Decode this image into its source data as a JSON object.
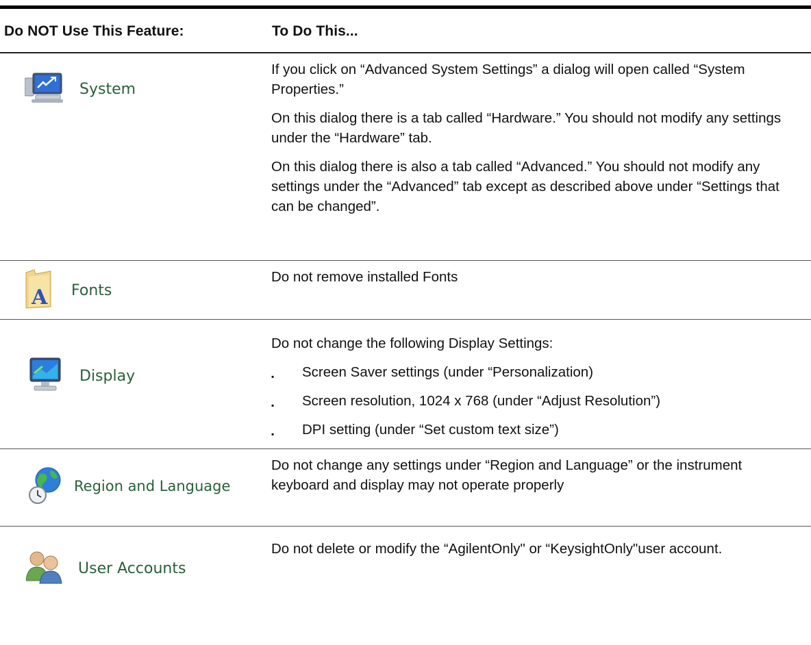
{
  "table": {
    "col1_header": "Do NOT Use This Feature:",
    "col2_header": "To Do This...",
    "rows": [
      {
        "feature": "System",
        "icon": "system-computer-icon",
        "paragraphs": [
          "If you click on “Advanced System Settings” a dialog will open called “System Properties.”",
          "On this dialog there is a tab called “Hardware.” You should not modify any settings under the “Hardware” tab.",
          "On this dialog there is also a tab called “Advanced.” You should not modify any settings under the “Advanced” tab except as described above under “Settings that can be changed”."
        ]
      },
      {
        "feature": "Fonts",
        "icon": "fonts-folder-icon",
        "paragraphs": [
          "Do not remove installed Fonts"
        ]
      },
      {
        "feature": "Display",
        "icon": "display-monitor-icon",
        "paragraphs": [
          "Do not change the following Display Settings:"
        ],
        "bullets": [
          "Screen Saver settings (under “Personalization)",
          "Screen resolution, 1024 x 768 (under “Adjust Resolution”)",
          "DPI setting (under “Set custom text size”)"
        ]
      },
      {
        "feature": "Region and Language",
        "icon": "globe-clock-icon",
        "paragraphs": [
          "Do not change any settings under “Region and Language” or the instrument keyboard and display may not operate properly"
        ]
      },
      {
        "feature": "User Accounts",
        "icon": "users-icon",
        "paragraphs": [
          "Do not delete or modify the “AgilentOnly\" or “KeysightOnly\"user account."
        ]
      }
    ],
    "bullet_glyph": "▪"
  }
}
